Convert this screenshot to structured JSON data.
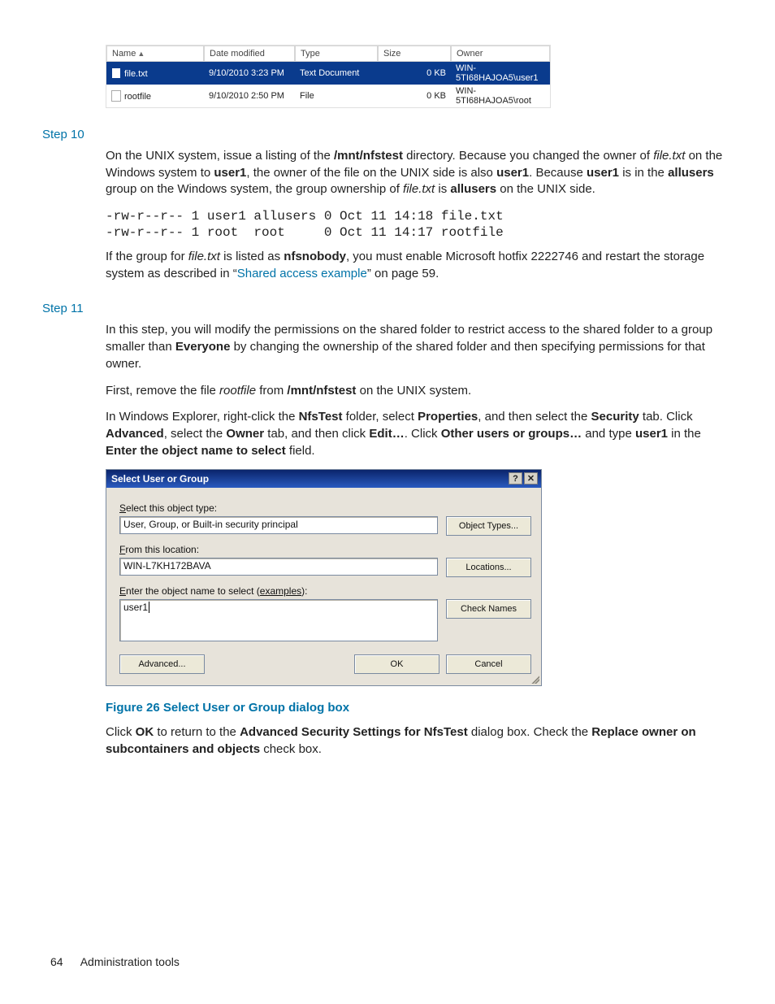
{
  "file_table": {
    "headers": [
      "Name",
      "Date modified",
      "Type",
      "Size",
      "Owner"
    ],
    "rows": [
      {
        "name": "file.txt",
        "date": "9/10/2010 3:23 PM",
        "type": "Text Document",
        "size": "0 KB",
        "owner": "WIN-5TI68HAJOA5\\user1"
      },
      {
        "name": "rootfile",
        "date": "9/10/2010 2:50 PM",
        "type": "File",
        "size": "0 KB",
        "owner": "WIN-5TI68HAJOA5\\root"
      }
    ]
  },
  "steps": {
    "ten": {
      "label": "Step 10"
    },
    "eleven": {
      "label": "Step 11"
    }
  },
  "para": {
    "p1_a": "On the UNIX system, issue a listing of the ",
    "p1_b": "/mnt/nfstest",
    "p1_c": " directory. Because you changed the owner of ",
    "p1_d": "file.txt",
    "p1_e": " on the Windows system to ",
    "p1_f": "user1",
    "p1_g": ", the owner of the file on the UNIX side is also ",
    "p1_h": "user1",
    "p1_i": ". Because ",
    "p1_j": "user1",
    "p1_k": " is in the ",
    "p1_l": "allusers",
    "p1_m": " group on the Windows system, the group ownership of ",
    "p1_n": "file.txt",
    "p1_o": " is ",
    "p1_p": "allusers",
    "p1_q": " on the UNIX side.",
    "code": "-rw-r--r-- 1 user1 allusers 0 Oct 11 14:18 file.txt\n-rw-r--r-- 1 root  root     0 Oct 11 14:17 rootfile",
    "p2_a": "If the group for ",
    "p2_b": "file.txt",
    "p2_c": " is listed as ",
    "p2_d": "nfsnobody",
    "p2_e": ", you must enable Microsoft hotfix 2222746 and restart the storage system as described in “",
    "p2_link": "Shared access example",
    "p2_f": "” on page 59.",
    "p3_a": "In this step, you will modify the permissions on the shared folder to restrict access to the shared folder to a group smaller than ",
    "p3_b": "Everyone",
    "p3_c": " by changing the ownership of the shared folder and then specifying permissions for that owner.",
    "p4_a": "First, remove the file ",
    "p4_b": "rootfile",
    "p4_c": " from ",
    "p4_d": "/mnt/nfstest",
    "p4_e": " on the UNIX system.",
    "p5_a": "In Windows Explorer, right-click the ",
    "p5_b": "NfsTest",
    "p5_c": " folder, select ",
    "p5_d": "Properties",
    "p5_e": ", and then select the ",
    "p5_f": "Security",
    "p5_g": " tab. Click ",
    "p5_h": "Advanced",
    "p5_i": ", select the ",
    "p5_j": "Owner",
    "p5_k": " tab, and then click ",
    "p5_l": "Edit…",
    "p5_m": ". Click ",
    "p5_n": "Other users or groups…",
    "p5_o": " and type ",
    "p5_p": "user1",
    "p5_q": " in the ",
    "p5_r": "Enter the object name to select",
    "p5_s": " field."
  },
  "dialog": {
    "title": "Select User or Group",
    "help_glyph": "?",
    "close_glyph": "✕",
    "label_object_type": "Select this object type:",
    "object_type_value": "User, Group, or Built-in security principal",
    "btn_object_types": "Object Types...",
    "label_from_location": "From this location:",
    "location_value": "WIN-L7KH172BAVA",
    "btn_locations": "Locations...",
    "label_enter_pre": "Enter the object name to select (",
    "label_enter_link": "examples",
    "label_enter_post": "):",
    "entry_value": "user1",
    "btn_check_names": "Check Names",
    "btn_advanced": "Advanced...",
    "btn_ok": "OK",
    "btn_cancel": "Cancel"
  },
  "figure": {
    "caption": "Figure 26 Select User or Group dialog box"
  },
  "para2": {
    "a": "Click ",
    "b": "OK",
    "c": " to return to the ",
    "d": "Advanced Security Settings for NfsTest",
    "e": " dialog box. Check the ",
    "f": "Replace owner on subcontainers and objects",
    "g": " check box."
  },
  "footer": {
    "page": "64",
    "section": "Administration tools"
  }
}
